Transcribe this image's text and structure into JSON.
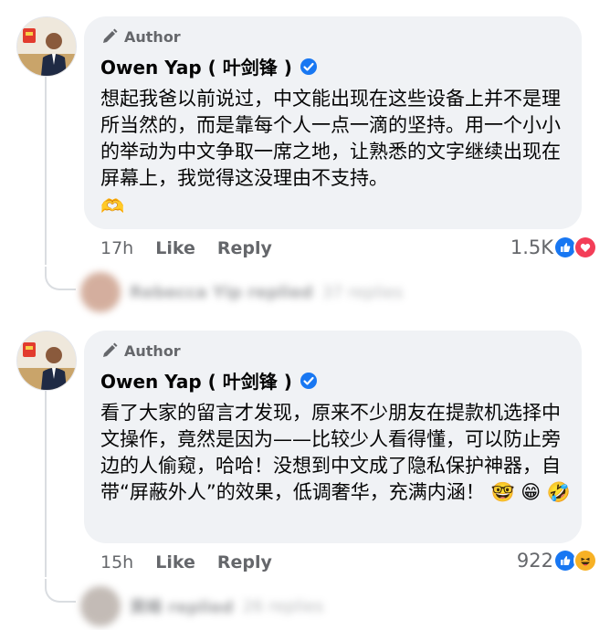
{
  "comments": [
    {
      "author_badge": "Author",
      "name": "Owen Yap ( 叶剑锋 )",
      "text": "想起我爸以前说过，中文能出现在这些设备上并不是理所当然的，而是靠每个人一点一滴的坚持。用一个小小的举动为中文争取一席之地，让熟悉的文字继续出现在屏幕上，我觉得这没理由不支持。",
      "emoji": "🫶",
      "time": "17h",
      "like_label": "Like",
      "reply_label": "Reply",
      "reaction_count": "1.5K",
      "reactions": [
        "like-icon",
        "love-icon"
      ],
      "reply_preview": {
        "name": "Rebecca Yip replied",
        "count": "37 replies"
      }
    },
    {
      "author_badge": "Author",
      "name": "Owen Yap ( 叶剑锋 )",
      "text": "看了大家的留言才发现，原来不少朋友在提款机选择中文操作，竟然是因为——比较少人看得懂，可以防止旁边的人偷窥，哈哈！没想到中文成了隐私保护神器，自带“屏蔽外人”的效果，低调奢华，充满内涵！",
      "emoji": "🤓 😁 🤣",
      "time": "15h",
      "like_label": "Like",
      "reply_label": "Reply",
      "reaction_count": "922",
      "reactions": [
        "like-icon",
        "haha-icon"
      ],
      "reply_preview": {
        "name": "黄峰 replied",
        "count": "26 replies"
      }
    }
  ],
  "colors": {
    "bubble": "#f0f2f5",
    "verified": "#1877f2",
    "like": "#1877f2",
    "love": "#f33e58",
    "haha": "#f7b125"
  }
}
